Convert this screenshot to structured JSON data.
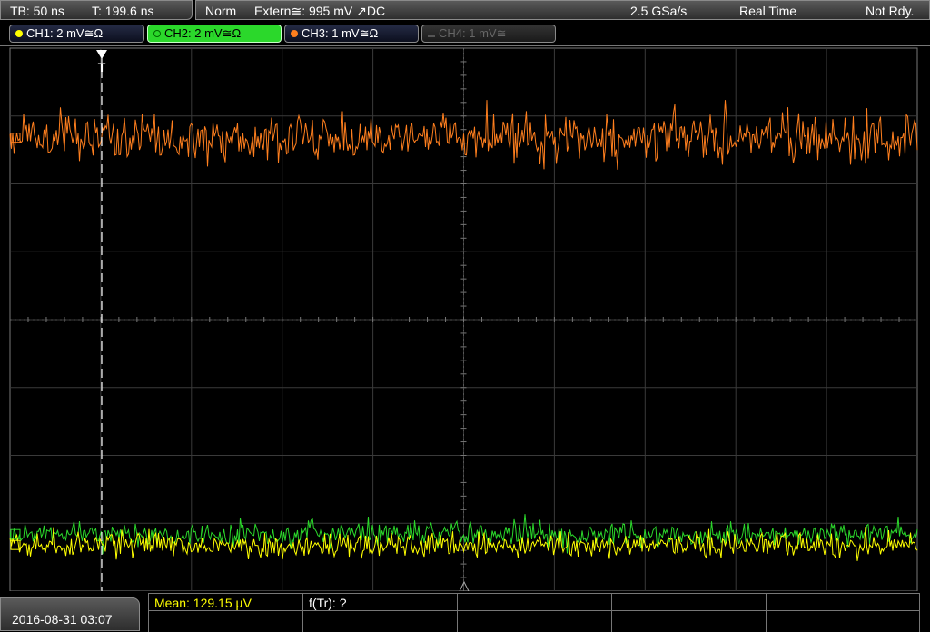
{
  "status": {
    "timebase": "TB: 50 ns",
    "trigger_time": "T: 199.6 ns",
    "mode": "Norm",
    "trigger": "Extern≅: 995 mV ↗DC",
    "sample_rate": "2.5 GSa/s",
    "acq_mode": "Real Time",
    "state": "Not Rdy."
  },
  "channels": [
    {
      "label": "CH1: 2 mV≅Ω",
      "color": "#ffff00",
      "state": "normal"
    },
    {
      "label": "CH2: 2 mV≅Ω",
      "color": "#2bd82b",
      "state": "active"
    },
    {
      "label": "CH3: 1 mV≅Ω",
      "color": "#ff7f1e",
      "state": "normal"
    },
    {
      "label": "CH4: 1 mV≅",
      "color": "#666666",
      "state": "off"
    }
  ],
  "trigger_marker": "T",
  "traces": [
    {
      "channel": "CH3",
      "color": "#ff7f1e",
      "level": 0.165,
      "amplitude": 0.085
    },
    {
      "channel": "CH2",
      "color": "#2bd82b",
      "level": 0.895,
      "amplitude": 0.045
    },
    {
      "channel": "CH1",
      "color": "#ffff00",
      "level": 0.915,
      "amplitude": 0.045
    }
  ],
  "footer": {
    "datetime": "2016-08-31 03:07",
    "measurement_1": "Mean: 129.15 µV",
    "measurement_1_color": "#ffff00",
    "measurement_2": "f(Tr): ?"
  }
}
